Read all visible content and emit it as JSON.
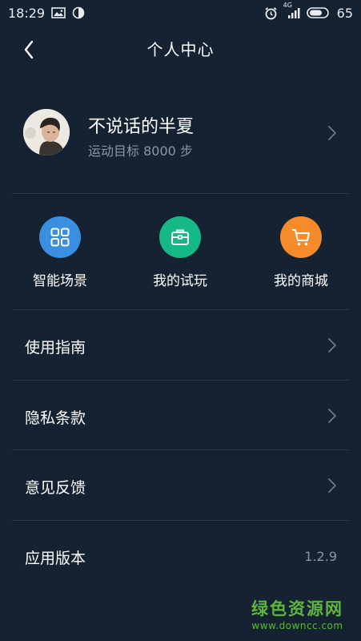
{
  "status_bar": {
    "time": "18:29",
    "network_type": "4G",
    "battery_level": "65",
    "icons": [
      "image-icon",
      "half-circle-icon",
      "alarm-icon",
      "signal-icon",
      "battery-icon"
    ]
  },
  "nav": {
    "title": "个人中心",
    "back_icon": "chevron-left-icon"
  },
  "profile": {
    "username": "不说话的半夏",
    "goal": "运动目标 8000 步",
    "avatar_icon": "avatar"
  },
  "actions": [
    {
      "label": "智能场景",
      "icon": "grid-icon",
      "color": "#3a8fe0"
    },
    {
      "label": "我的试玩",
      "icon": "briefcase-icon",
      "color": "#15b985"
    },
    {
      "label": "我的商城",
      "icon": "cart-icon",
      "color": "#f58b2a"
    }
  ],
  "list": [
    {
      "label": "使用指南"
    },
    {
      "label": "隐私条款"
    },
    {
      "label": "意见反馈"
    },
    {
      "label": "应用版本",
      "value": "1.2.9"
    }
  ],
  "watermark": {
    "brand": "绿色资源网",
    "url": "www.downcc.com"
  },
  "colors": {
    "background": "#152231",
    "divider": "#2a3747",
    "secondary_text": "#8b96a3",
    "watermark": "#5fb53e"
  }
}
